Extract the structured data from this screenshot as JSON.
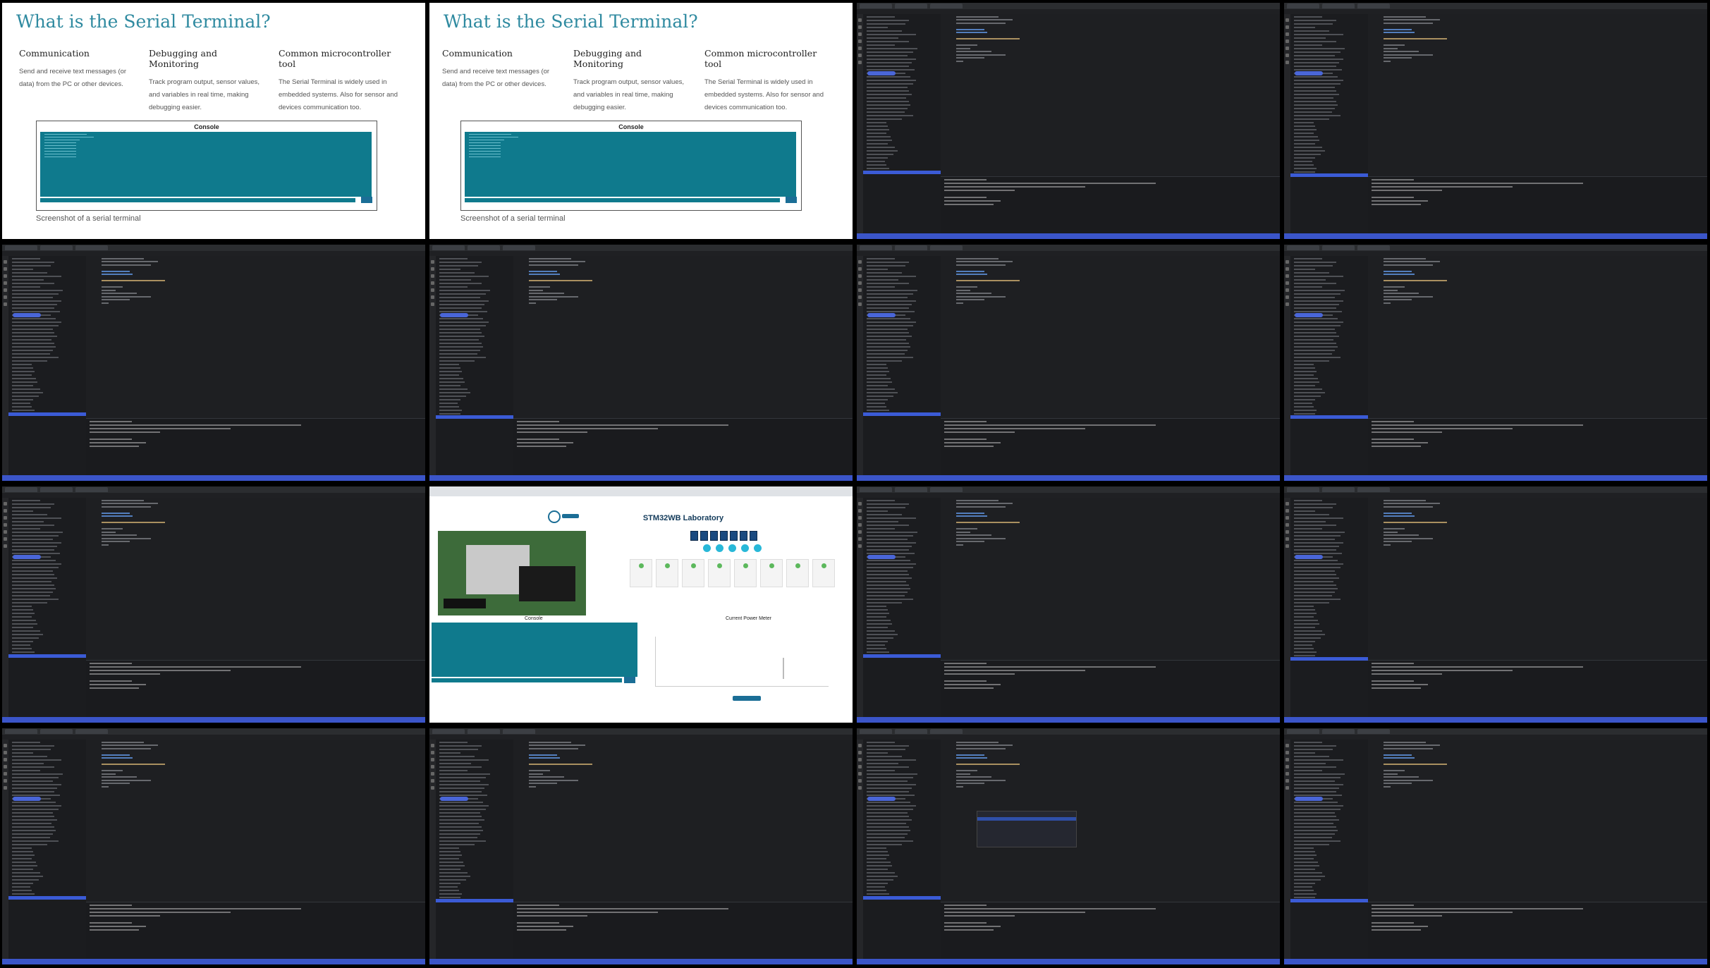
{
  "slide": {
    "title": "What is the Serial Terminal?",
    "columns": [
      {
        "heading": "Communication",
        "text": "Send and receive text messages (or data) from the PC or other devices."
      },
      {
        "heading": "Debugging and Monitoring",
        "text": "Track program output, sensor values, and variables in real time, making debugging easier."
      },
      {
        "heading": "Common microcontroller tool",
        "text": "The Serial Terminal is widely used in embedded systems. Also for sensor and devices communication too."
      }
    ],
    "console_title": "Console",
    "caption": "Screenshot of a serial terminal"
  },
  "lab": {
    "title": "STM32WB Laboratory",
    "console_label": "Console",
    "meter_label": "Current Power Meter"
  },
  "layout": {
    "tiles": [
      "slide",
      "slide",
      "editor",
      "editor",
      "editor",
      "editor",
      "editor",
      "editor",
      "editor",
      "lab",
      "editor",
      "editor",
      "editor",
      "editor",
      "editor-popup",
      "editor"
    ]
  }
}
